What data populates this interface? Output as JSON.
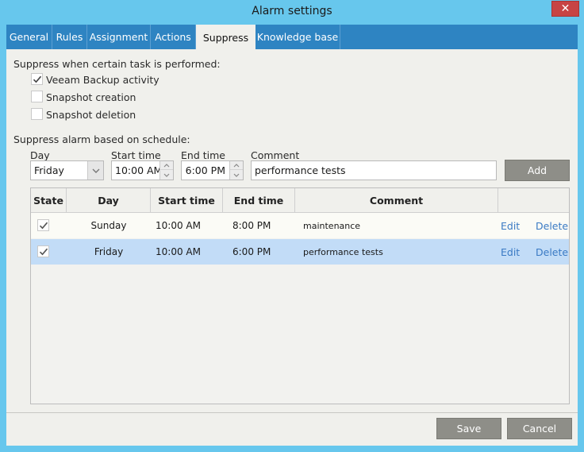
{
  "window": {
    "title": "Alarm settings",
    "close_glyph": "✕"
  },
  "tabs": [
    {
      "label": "General"
    },
    {
      "label": "Rules"
    },
    {
      "label": "Assignment"
    },
    {
      "label": "Actions"
    },
    {
      "label": "Suppress"
    },
    {
      "label": "Knowledge base"
    }
  ],
  "active_tab": "Suppress",
  "suppress_task": {
    "heading": "Suppress when certain task is performed:",
    "options": [
      {
        "label": "Veeam Backup activity",
        "checked": true
      },
      {
        "label": "Snapshot creation",
        "checked": false
      },
      {
        "label": "Snapshot deletion",
        "checked": false
      }
    ]
  },
  "schedule": {
    "heading": "Suppress alarm based on schedule:",
    "day_label": "Day",
    "day_value": "Friday",
    "start_label": "Start time",
    "start_value": "10:00 AM",
    "end_label": "End time",
    "end_value": "6:00 PM",
    "comment_label": "Comment",
    "comment_value": "performance tests",
    "add_label": "Add"
  },
  "grid": {
    "columns": [
      "State",
      "Day",
      "Start time",
      "End time",
      "Comment"
    ],
    "rows": [
      {
        "checked": true,
        "day": "Sunday",
        "start": "10:00 AM",
        "end": "8:00 PM",
        "comment": "maintenance",
        "edit": "Edit",
        "delete": "Delete",
        "selected": false
      },
      {
        "checked": true,
        "day": "Friday",
        "start": "10:00 AM",
        "end": "6:00 PM",
        "comment": "performance tests",
        "edit": "Edit",
        "delete": "Delete",
        "selected": true
      }
    ]
  },
  "footer": {
    "save_label": "Save",
    "cancel_label": "Cancel"
  },
  "colors": {
    "title_bar": "#67c7ed",
    "tab_bar": "#2e84c2",
    "selected_row": "#c2dcf7",
    "link": "#3a7ac4",
    "button": "#8e8e88"
  }
}
